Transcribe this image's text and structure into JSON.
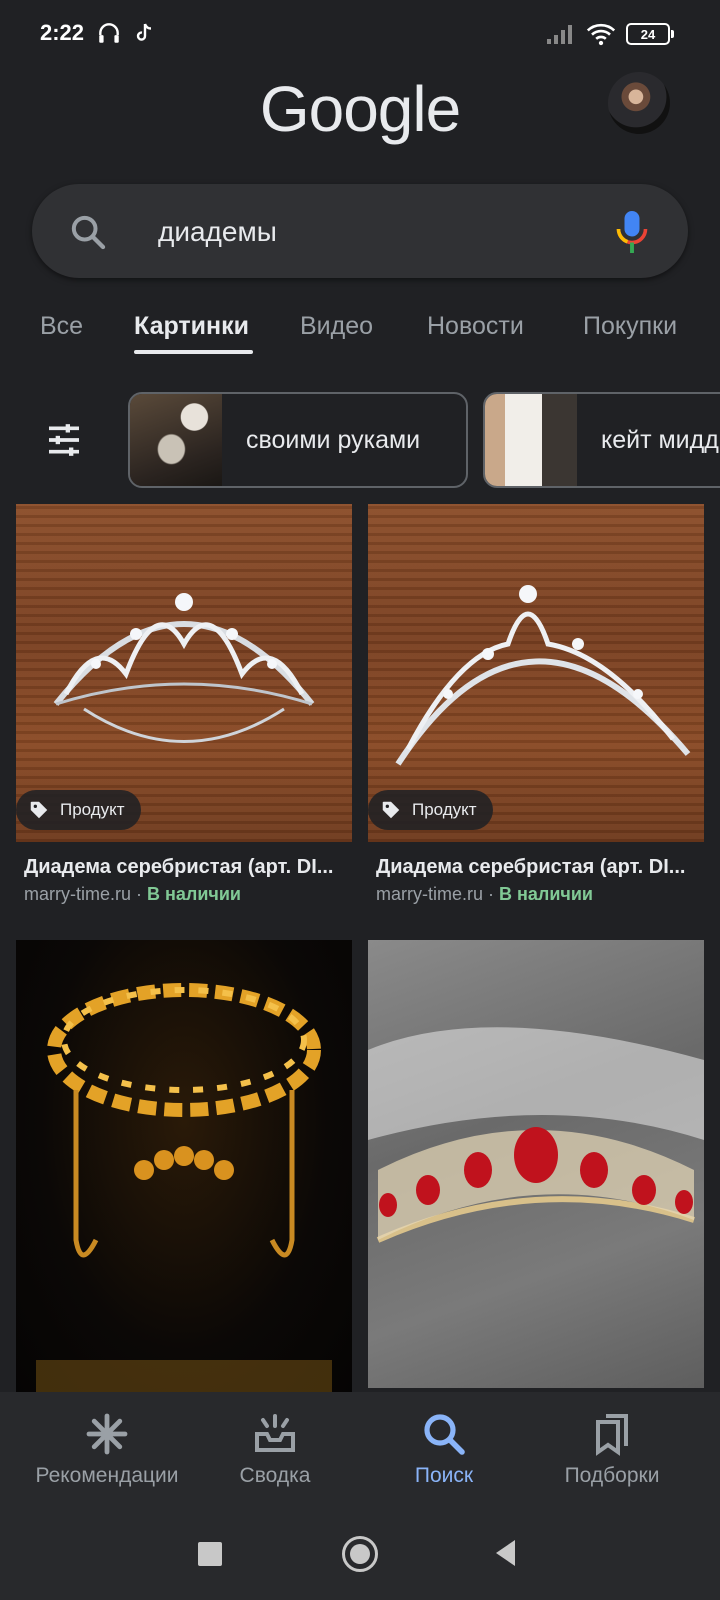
{
  "status_bar": {
    "time": "2:22",
    "battery": "24",
    "icons": [
      "headphones-icon",
      "tiktok-icon",
      "signal-icon",
      "wifi-icon",
      "battery-icon"
    ]
  },
  "header": {
    "logo": "Google"
  },
  "search": {
    "query": "диадемы"
  },
  "tabs": [
    {
      "label": "Все"
    },
    {
      "label": "Картинки",
      "active": true
    },
    {
      "label": "Видео"
    },
    {
      "label": "Новости"
    },
    {
      "label": "Покупки"
    }
  ],
  "chips": [
    {
      "label": "своими руками"
    },
    {
      "label": "кейт мидд"
    }
  ],
  "results": [
    {
      "badge": "Продукт",
      "title": "Диадема серебристая (арт. DI...",
      "source": "marry-time.ru",
      "separator": " · ",
      "availability": "В наличии"
    },
    {
      "badge": "Продукт",
      "title": "Диадема серебристая (арт. DI...",
      "source": "marry-time.ru",
      "separator": " · ",
      "availability": "В наличии"
    },
    {},
    {}
  ],
  "bottom_nav": [
    {
      "label": "Рекомендации",
      "icon": "asterisk-icon"
    },
    {
      "label": "Сводка",
      "icon": "inbox-icon"
    },
    {
      "label": "Поиск",
      "icon": "search-icon",
      "active": true
    },
    {
      "label": "Подборки",
      "icon": "bookmarks-icon"
    }
  ],
  "colors": {
    "background": "#202124",
    "active_tab_blue": "#8ab4f8",
    "in_stock_green": "#81c995"
  }
}
